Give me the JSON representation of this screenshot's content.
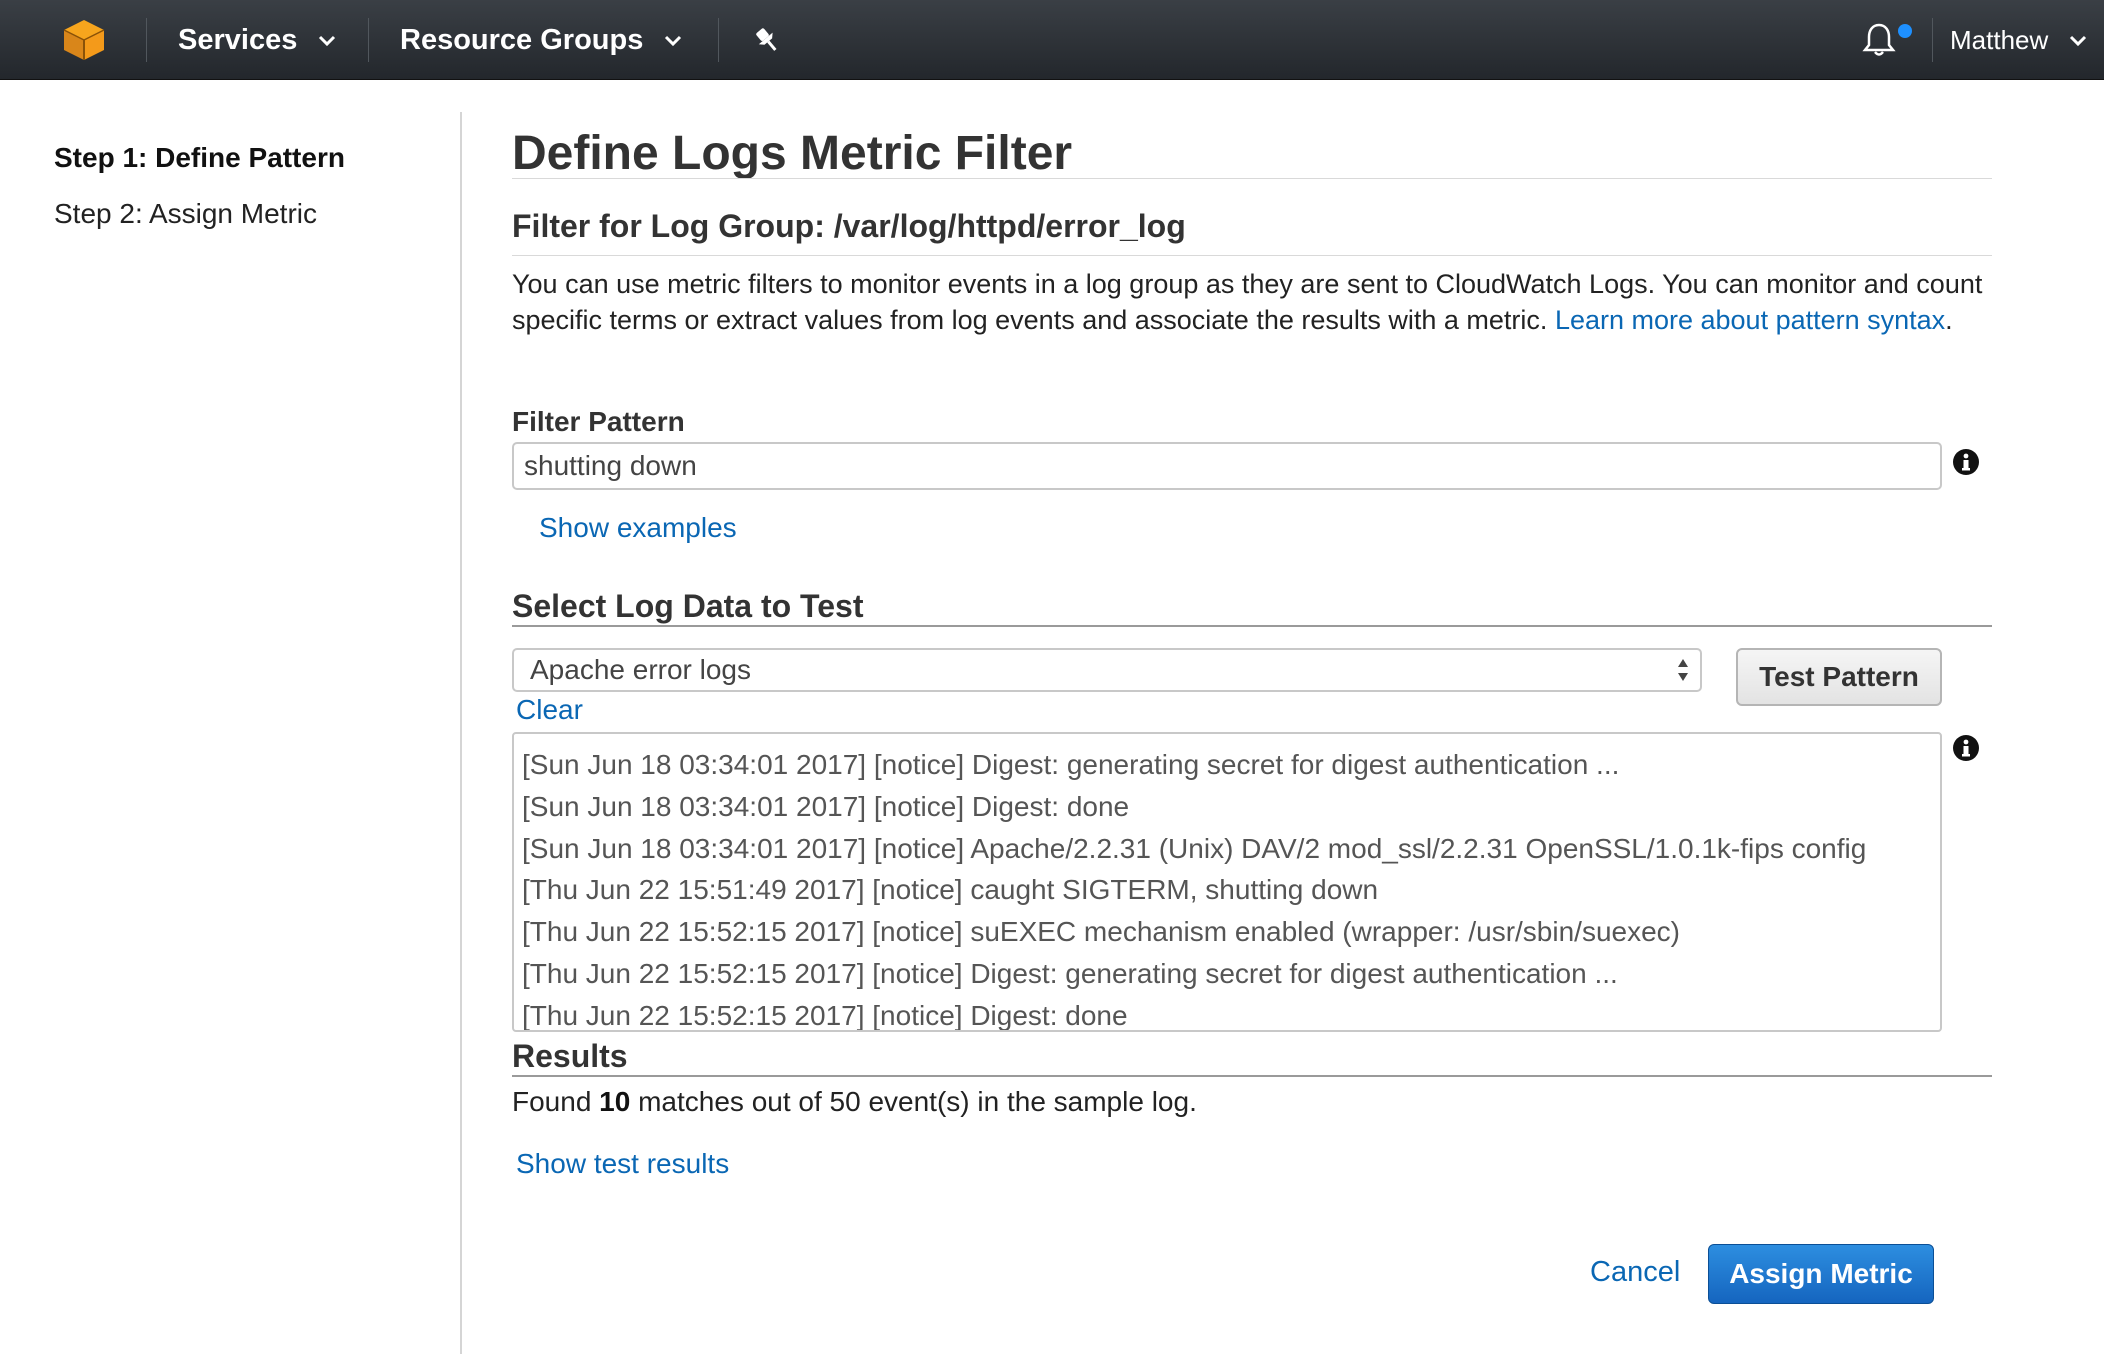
{
  "nav": {
    "services_label": "Services",
    "resource_groups_label": "Resource Groups",
    "user_label": "Matthew",
    "logo_icon": "aws-cube-icon",
    "pin_icon": "pushpin-icon",
    "bell_icon": "bell-icon",
    "colors": {
      "bar": "#2a2f35",
      "logo": "#f7a51d",
      "notify": "#1e90ff"
    }
  },
  "sidebar": {
    "steps": [
      {
        "label": "Step 1: Define Pattern",
        "active": true
      },
      {
        "label": "Step 2: Assign Metric",
        "active": false
      }
    ]
  },
  "main": {
    "title": "Define Logs Metric Filter",
    "filter_group_title": "Filter for Log Group: /var/log/httpd/error_log",
    "description": "You can use metric filters to monitor events in a log group as they are sent to CloudWatch Logs. You can monitor and count specific terms or extract values from log events and associate the results with a metric.",
    "learn_more_link": "Learn more about pattern syntax",
    "description_end": ".",
    "filter_pattern_label": "Filter Pattern",
    "filter_pattern_value": "shutting down",
    "show_examples_link": "Show examples",
    "select_log_title": "Select Log Data to Test",
    "log_select_value": "Apache error logs",
    "test_pattern_button": "Test Pattern",
    "clear_link": "Clear",
    "log_lines": [
      "[Sun Jun 18 03:34:01 2017] [notice] Digest: generating secret for digest authentication ...",
      "[Sun Jun 18 03:34:01 2017] [notice] Digest: done",
      "[Sun Jun 18 03:34:01 2017] [notice] Apache/2.2.31 (Unix) DAV/2 mod_ssl/2.2.31 OpenSSL/1.0.1k-fips config",
      "[Thu Jun 22 15:51:49 2017] [notice] caught SIGTERM, shutting down",
      "[Thu Jun 22 15:52:15 2017] [notice] suEXEC mechanism enabled (wrapper: /usr/sbin/suexec)",
      "[Thu Jun 22 15:52:15 2017] [notice] Digest: generating secret for digest authentication ...",
      "[Thu Jun 22 15:52:15 2017] [notice] Digest: done"
    ],
    "results_title": "Results",
    "results_prefix": "Found ",
    "results_count": "10",
    "results_suffix": " matches out of 50 event(s) in the sample log.",
    "show_test_results_link": "Show test results",
    "cancel_label": "Cancel",
    "assign_metric_button": "Assign Metric",
    "colors": {
      "link": "#0a67b4",
      "primary": "#1d77d2"
    }
  }
}
